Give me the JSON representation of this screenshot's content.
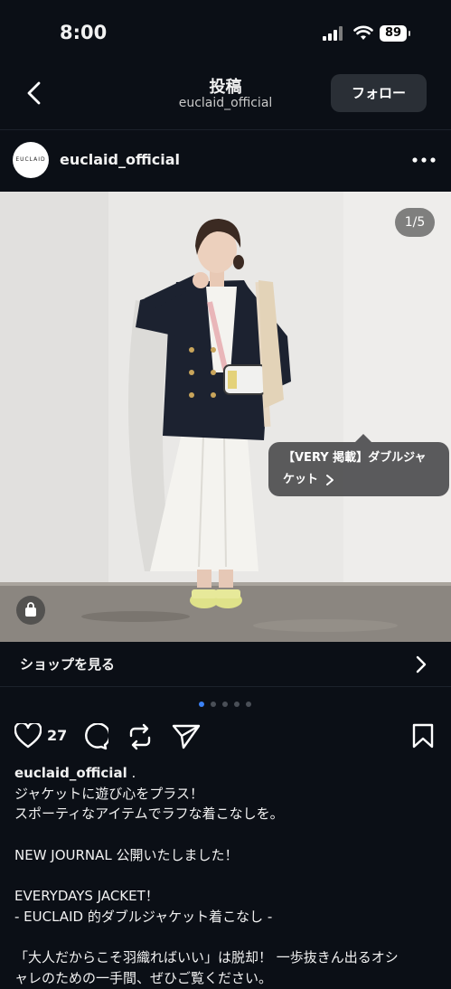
{
  "status_bar": {
    "time": "8:00",
    "battery": "89"
  },
  "header": {
    "title": "投稿",
    "subtitle": "euclaid_official",
    "follow_label": "フォロー"
  },
  "profile": {
    "username": "euclaid_official",
    "avatar_text": "EUCLAID"
  },
  "media": {
    "counter": "1/5",
    "tag_line1": "【VERY 掲載】ダブルジャ",
    "tag_line2": "ケット",
    "active_dot": 0,
    "dot_count": 5
  },
  "shop": {
    "label": "ショップを見る"
  },
  "actions": {
    "like_count": "27"
  },
  "caption": {
    "username": "euclaid_official",
    "suffix": " .",
    "lines": [
      "ジャケットに遊び心をプラス！",
      "スポーティなアイテムでラフな着こなしを。",
      "",
      "NEW JOURNAL 公開いたしました！",
      "",
      "EVERYDAYS JACKET！",
      "- EUCLAID 的ダブルジャケット着こなし -",
      "",
      "「大人だからこそ羽織ればいい」は脱却！ 一歩抜きん出るオシ",
      "ャレのための一手間、ぜひご覧ください。"
    ]
  },
  "colors": {
    "background": "#0b0f16",
    "accent_dot": "#3b82f6",
    "wall": "#e9e8e6",
    "floor": "#8b8680",
    "jacket": "#1c2230"
  }
}
